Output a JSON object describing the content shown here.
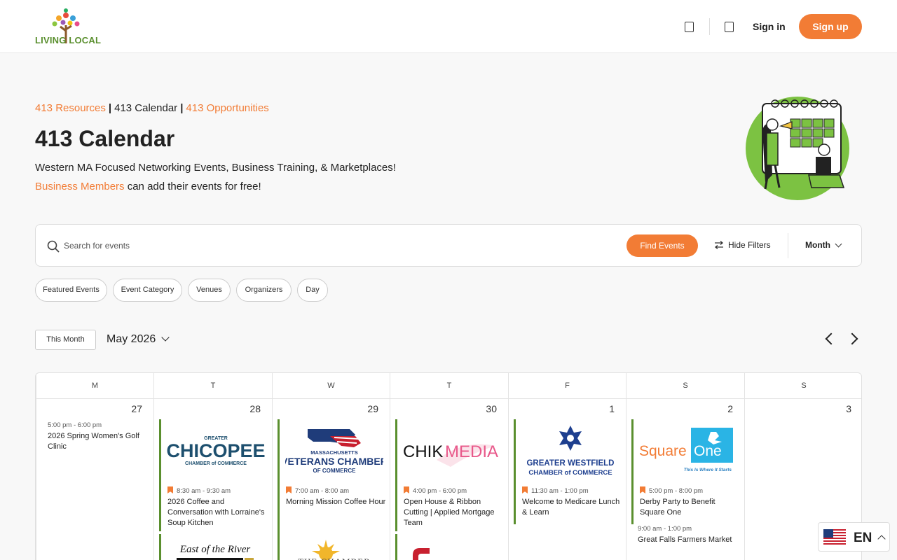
{
  "header": {
    "logo_text_1": "LIVING",
    "logo_text_2": "LOCAL",
    "sign_in": "Sign in",
    "sign_up": "Sign up",
    "icons": [
      "bookmark-icon",
      "cart-icon"
    ]
  },
  "hero": {
    "breadcrumbs": {
      "resources": "413 Resources",
      "calendar": "413 Calendar",
      "opportunities": "413 Opportunities",
      "separator": "|"
    },
    "title": "413 Calendar",
    "subtitle": "Western MA Focused Networking Events, Business Training, & Marketplaces!",
    "members_link": "Business Members",
    "members_text": "can add their events for free!"
  },
  "search": {
    "placeholder": "Search for events",
    "find_button": "Find Events",
    "hide_filters": "Hide Filters",
    "view_select": "Month"
  },
  "filters": [
    "Featured Events",
    "Event Category",
    "Venues",
    "Organizers",
    "Day"
  ],
  "month_nav": {
    "this_month": "This Month",
    "current": "May 2026"
  },
  "calendar": {
    "weekdays": [
      "M",
      "T",
      "W",
      "T",
      "F",
      "S",
      "S"
    ],
    "days": [
      {
        "num": "27",
        "events": [
          {
            "time": "5:00 pm - 6:00 pm",
            "title": "2026 Spring Women's Golf Clinic",
            "image": ""
          }
        ]
      },
      {
        "num": "28",
        "events": [
          {
            "time": "8:30 am - 9:30 am",
            "title": "2026 Coffee and Conversation with Lorraine's Soup Kitchen",
            "image": "GREATER CHICOPEE CHAMBER of COMMERCE"
          }
        ]
      },
      {
        "num": "29",
        "events": [
          {
            "time": "7:00 am - 8:00 am",
            "title": "Morning Mission Coffee Hour",
            "image": "MASSACHUSETTS VETERANS CHAMBER OF COMMERCE"
          }
        ]
      },
      {
        "num": "30",
        "events": [
          {
            "time": "4:00 pm - 6:00 pm",
            "title": "Open House & Ribbon Cutting | Applied Mortgage Team",
            "image": "CHIKMEDIA"
          }
        ]
      },
      {
        "num": "1",
        "events": [
          {
            "time": "11:30 am - 1:00 pm",
            "title": "Welcome to Medicare Lunch & Learn",
            "image": "GREATER WESTFIELD CHAMBER of COMMERCE"
          }
        ]
      },
      {
        "num": "2",
        "events": [
          {
            "time": "5:00 pm - 8:00 pm",
            "title": "Derby Party to Benefit Square One",
            "image": "Square One This Is Where It Starts"
          },
          {
            "time": "9:00 am - 1:00 pm",
            "title": "Great Falls Farmers Market",
            "image": ""
          }
        ]
      },
      {
        "num": "3",
        "events": []
      }
    ],
    "partial_logos": [
      "East of the River",
      "THE CHAMBER",
      "Springfield"
    ]
  },
  "colors": {
    "accent": "#f27c35",
    "event_bar": "#5a8f2e",
    "logo_green": "#5a8f2e"
  },
  "language": {
    "code": "EN"
  }
}
